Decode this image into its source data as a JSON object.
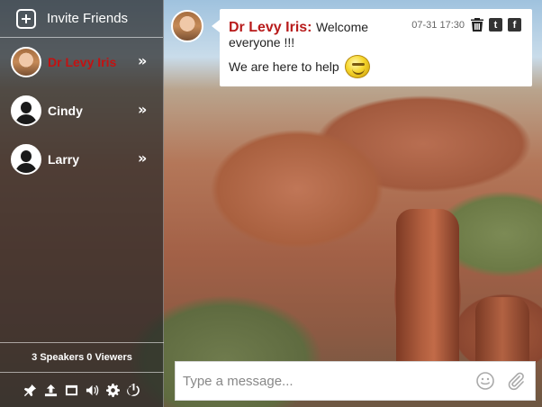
{
  "sidebar": {
    "invite_label": "Invite Friends",
    "users": [
      {
        "name": "Dr Levy Iris",
        "active": true
      },
      {
        "name": "Cindy",
        "active": false
      },
      {
        "name": "Larry",
        "active": false
      }
    ],
    "counts": "3 Speakers 0 Viewers",
    "toolbar_icons": [
      "pin-icon",
      "upload-icon",
      "window-icon",
      "volume-icon",
      "gear-icon",
      "power-icon"
    ]
  },
  "message": {
    "sender": "Dr Levy Iris:",
    "line1": "Welcome everyone !!!",
    "line2": "We are here to help",
    "timestamp": "07-31 17:30",
    "actions": [
      "trash-icon",
      "twitter-icon",
      "facebook-icon"
    ],
    "twitter_glyph": "t",
    "facebook_glyph": "f"
  },
  "composer": {
    "placeholder": "Type a message..."
  },
  "colors": {
    "active_user": "#c21212",
    "sender": "#b81b1b"
  }
}
